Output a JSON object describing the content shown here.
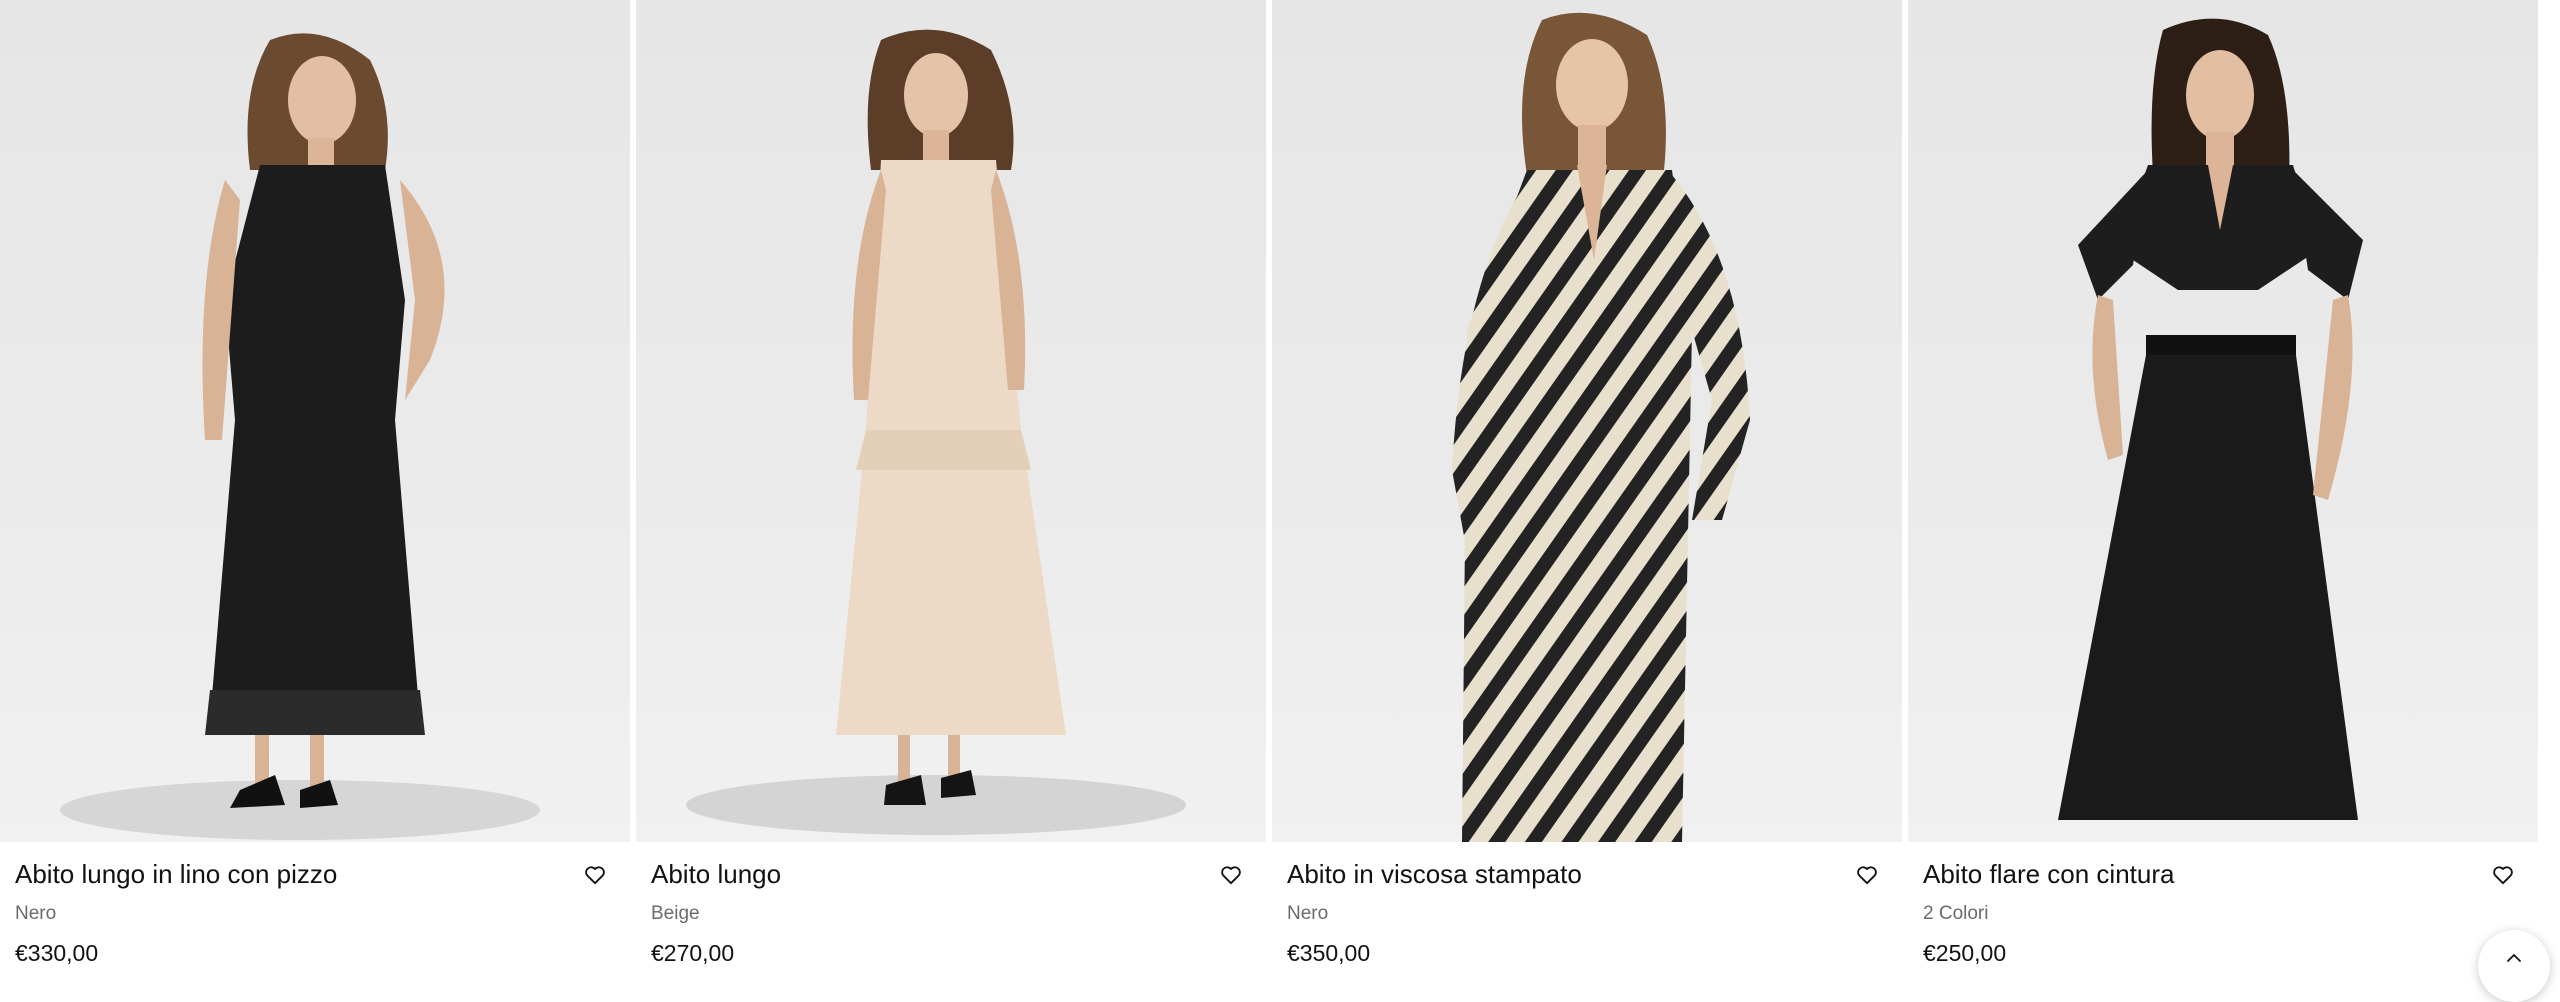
{
  "products": [
    {
      "name": "Abito lungo in lino con pizzo",
      "color": "Nero",
      "price": "€330,00",
      "image_icon": "black-lace-maxi-dress-photo",
      "dress_color": "#1c1c1c"
    },
    {
      "name": "Abito lungo",
      "color": "Beige",
      "price": "€270,00",
      "image_icon": "beige-maxi-dress-photo",
      "dress_color": "#ecd9c6"
    },
    {
      "name": "Abito in viscosa stampato",
      "color": "Nero",
      "price": "€350,00",
      "image_icon": "printed-wrap-dress-photo",
      "dress_color": "#2a2a2a"
    },
    {
      "name": "Abito flare con cintura",
      "color": "2 Colori",
      "price": "€250,00",
      "image_icon": "black-flare-dress-photo",
      "dress_color": "#1a1a1a"
    }
  ],
  "icons": {
    "favorite": "heart-outline-icon",
    "scroll_top": "chevron-up-icon"
  },
  "colors": {
    "photo_background": "#e8e8e8",
    "text": "#111111",
    "secondary_text": "#6b6b6b"
  }
}
